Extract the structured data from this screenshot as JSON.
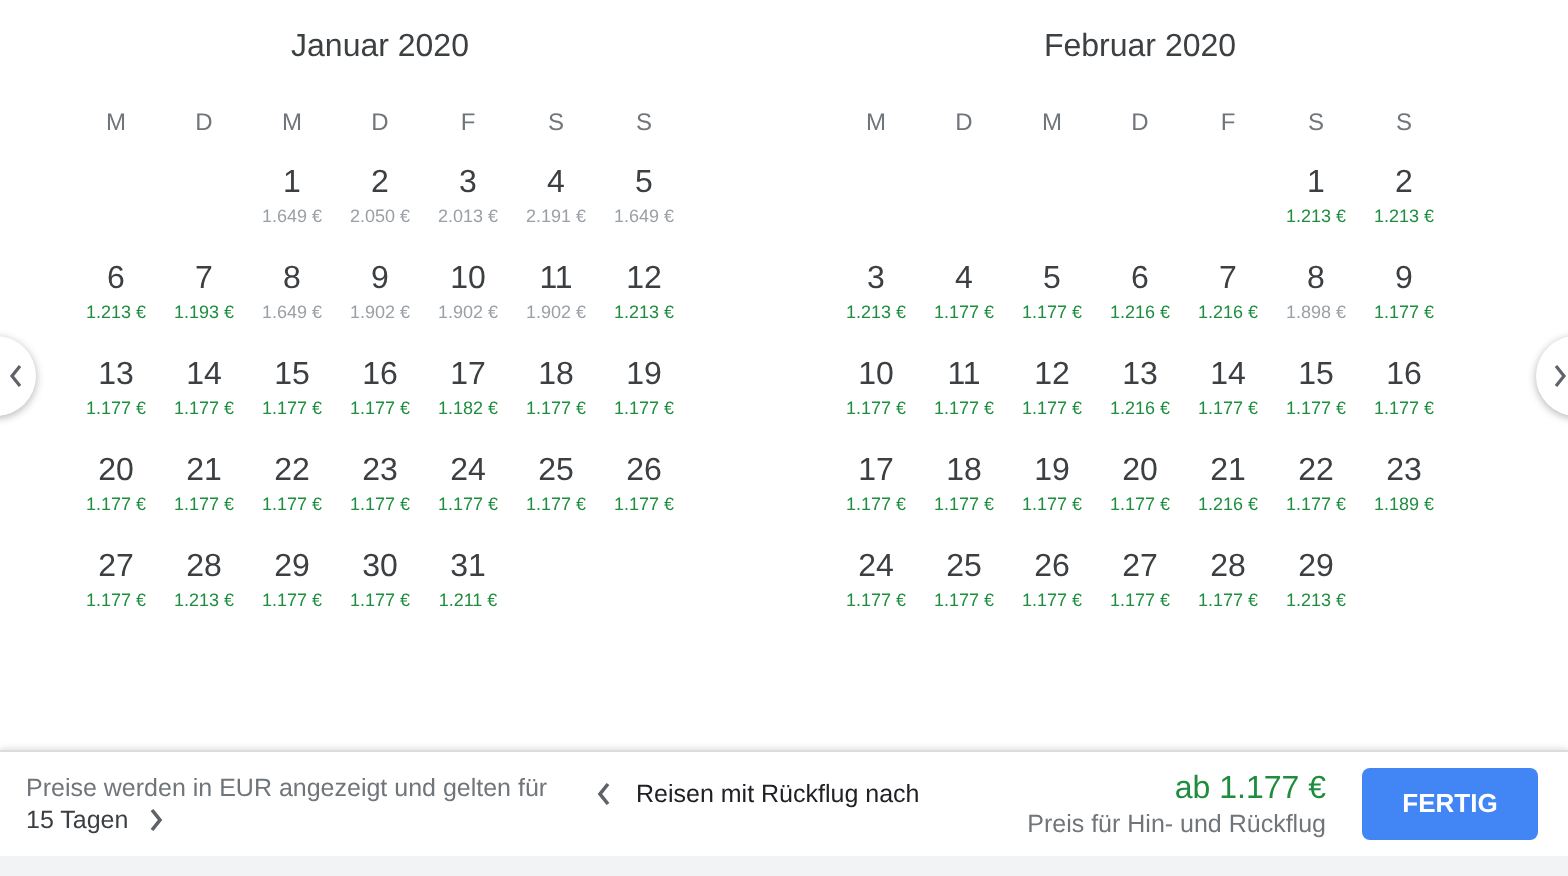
{
  "months": [
    {
      "title": "Januar 2020",
      "weekday_headers": [
        "M",
        "D",
        "M",
        "D",
        "F",
        "S",
        "S"
      ],
      "weeks": [
        [
          {
            "kind": "empty"
          },
          {
            "kind": "empty"
          },
          {
            "kind": "date",
            "day": "1",
            "price": "1.649 €",
            "low": false
          },
          {
            "kind": "date",
            "day": "2",
            "price": "2.050 €",
            "low": false
          },
          {
            "kind": "date",
            "day": "3",
            "price": "2.013 €",
            "low": false
          },
          {
            "kind": "date",
            "day": "4",
            "price": "2.191 €",
            "low": false
          },
          {
            "kind": "date",
            "day": "5",
            "price": "1.649 €",
            "low": false
          }
        ],
        [
          {
            "kind": "date",
            "day": "6",
            "price": "1.213 €",
            "low": true
          },
          {
            "kind": "date",
            "day": "7",
            "price": "1.193 €",
            "low": true
          },
          {
            "kind": "date",
            "day": "8",
            "price": "1.649 €",
            "low": false
          },
          {
            "kind": "date",
            "day": "9",
            "price": "1.902 €",
            "low": false
          },
          {
            "kind": "date",
            "day": "10",
            "price": "1.902 €",
            "low": false
          },
          {
            "kind": "date",
            "day": "11",
            "price": "1.902 €",
            "low": false
          },
          {
            "kind": "date",
            "day": "12",
            "price": "1.213 €",
            "low": true
          }
        ],
        [
          {
            "kind": "date",
            "day": "13",
            "price": "1.177 €",
            "low": true
          },
          {
            "kind": "date",
            "day": "14",
            "price": "1.177 €",
            "low": true
          },
          {
            "kind": "date",
            "day": "15",
            "price": "1.177 €",
            "low": true
          },
          {
            "kind": "date",
            "day": "16",
            "price": "1.177 €",
            "low": true
          },
          {
            "kind": "date",
            "day": "17",
            "price": "1.182 €",
            "low": true
          },
          {
            "kind": "date",
            "day": "18",
            "price": "1.177 €",
            "low": true
          },
          {
            "kind": "date",
            "day": "19",
            "price": "1.177 €",
            "low": true
          }
        ],
        [
          {
            "kind": "date",
            "day": "20",
            "price": "1.177 €",
            "low": true
          },
          {
            "kind": "date",
            "day": "21",
            "price": "1.177 €",
            "low": true
          },
          {
            "kind": "date",
            "day": "22",
            "price": "1.177 €",
            "low": true
          },
          {
            "kind": "date",
            "day": "23",
            "price": "1.177 €",
            "low": true
          },
          {
            "kind": "date",
            "day": "24",
            "price": "1.177 €",
            "low": true
          },
          {
            "kind": "date",
            "day": "25",
            "price": "1.177 €",
            "low": true
          },
          {
            "kind": "date",
            "day": "26",
            "price": "1.177 €",
            "low": true
          }
        ],
        [
          {
            "kind": "date",
            "day": "27",
            "price": "1.177 €",
            "low": true
          },
          {
            "kind": "date",
            "day": "28",
            "price": "1.213 €",
            "low": true
          },
          {
            "kind": "date",
            "day": "29",
            "price": "1.177 €",
            "low": true
          },
          {
            "kind": "date",
            "day": "30",
            "price": "1.177 €",
            "low": true
          },
          {
            "kind": "date",
            "day": "31",
            "price": "1.211 €",
            "low": true
          }
        ]
      ]
    },
    {
      "title": "Februar 2020",
      "weekday_headers": [
        "M",
        "D",
        "M",
        "D",
        "F",
        "S",
        "S"
      ],
      "weeks": [
        [
          {
            "kind": "empty"
          },
          {
            "kind": "empty"
          },
          {
            "kind": "empty"
          },
          {
            "kind": "empty"
          },
          {
            "kind": "empty"
          },
          {
            "kind": "date",
            "day": "1",
            "price": "1.213 €",
            "low": true
          },
          {
            "kind": "date",
            "day": "2",
            "price": "1.213 €",
            "low": true
          }
        ],
        [
          {
            "kind": "date",
            "day": "3",
            "price": "1.213 €",
            "low": true
          },
          {
            "kind": "date",
            "day": "4",
            "price": "1.177 €",
            "low": true
          },
          {
            "kind": "date",
            "day": "5",
            "price": "1.177 €",
            "low": true
          },
          {
            "kind": "date",
            "day": "6",
            "price": "1.216 €",
            "low": true
          },
          {
            "kind": "date",
            "day": "7",
            "price": "1.216 €",
            "low": true
          },
          {
            "kind": "date",
            "day": "8",
            "price": "1.898 €",
            "low": false
          },
          {
            "kind": "date",
            "day": "9",
            "price": "1.177 €",
            "low": true
          }
        ],
        [
          {
            "kind": "date",
            "day": "10",
            "price": "1.177 €",
            "low": true
          },
          {
            "kind": "date",
            "day": "11",
            "price": "1.177 €",
            "low": true
          },
          {
            "kind": "date",
            "day": "12",
            "price": "1.177 €",
            "low": true
          },
          {
            "kind": "date",
            "day": "13",
            "price": "1.216 €",
            "low": true
          },
          {
            "kind": "date",
            "day": "14",
            "price": "1.177 €",
            "low": true
          },
          {
            "kind": "date",
            "day": "15",
            "price": "1.177 €",
            "low": true
          },
          {
            "kind": "date",
            "day": "16",
            "price": "1.177 €",
            "low": true
          }
        ],
        [
          {
            "kind": "date",
            "day": "17",
            "price": "1.177 €",
            "low": true
          },
          {
            "kind": "date",
            "day": "18",
            "price": "1.177 €",
            "low": true
          },
          {
            "kind": "date",
            "day": "19",
            "price": "1.177 €",
            "low": true
          },
          {
            "kind": "date",
            "day": "20",
            "price": "1.177 €",
            "low": true
          },
          {
            "kind": "date",
            "day": "21",
            "price": "1.216 €",
            "low": true
          },
          {
            "kind": "date",
            "day": "22",
            "price": "1.177 €",
            "low": true
          },
          {
            "kind": "date",
            "day": "23",
            "price": "1.189 €",
            "low": true
          }
        ],
        [
          {
            "kind": "date",
            "day": "24",
            "price": "1.177 €",
            "low": true
          },
          {
            "kind": "date",
            "day": "25",
            "price": "1.177 €",
            "low": true
          },
          {
            "kind": "date",
            "day": "26",
            "price": "1.177 €",
            "low": true
          },
          {
            "kind": "date",
            "day": "27",
            "price": "1.177 €",
            "low": true
          },
          {
            "kind": "date",
            "day": "28",
            "price": "1.177 €",
            "low": true
          },
          {
            "kind": "date",
            "day": "29",
            "price": "1.213 €",
            "low": true
          }
        ]
      ]
    }
  ],
  "footer": {
    "note": "Preise werden in EUR angezeigt und gelten für",
    "duration": "15 Tagen",
    "trip_label": "Reisen mit Rückflug nach",
    "price": "ab 1.177 €",
    "price_caption": "Preis für Hin- und Rückflug",
    "done_button": "FERTIG"
  }
}
